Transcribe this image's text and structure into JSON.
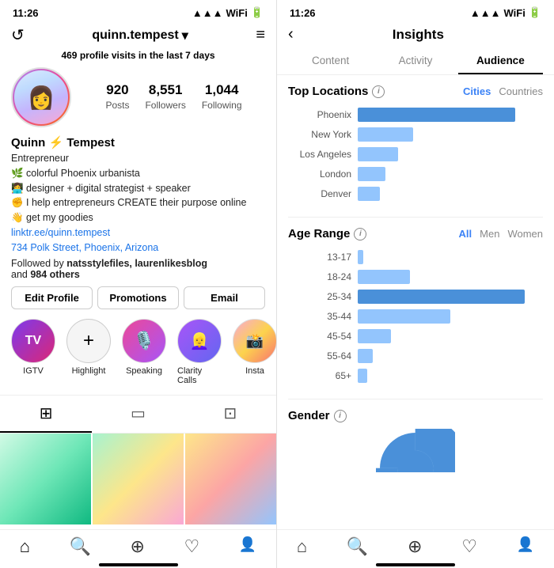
{
  "left": {
    "status_time": "11:26",
    "header": {
      "username": "quinn.tempest",
      "dropdown_icon": "▾",
      "menu_icon": "≡"
    },
    "visits_text": "profile visits in the last 7 days",
    "visits_count": "469",
    "stats": {
      "posts": {
        "value": "920",
        "label": "Posts"
      },
      "followers": {
        "value": "8,551",
        "label": "Followers"
      },
      "following": {
        "value": "1,044",
        "label": "Following"
      }
    },
    "profile_name": "Quinn ⚡ Tempest",
    "bio_lines": [
      "Entrepreneur",
      "🌿 colorful Phoenix urbanista",
      "👩‍💻 designer + digital strategist + speaker",
      "✊ I help entrepreneurs CREATE their purpose online",
      "👋 get my goodies"
    ],
    "link": "linktr.ee/quinn.tempest",
    "address": "734 Polk Street, Phoenix, Arizona",
    "followed_by": "Followed by natsstylefiles, laurenlikesblog",
    "followed_others": "and 984 others",
    "buttons": {
      "edit": "Edit Profile",
      "promotions": "Promotions",
      "email": "Email"
    },
    "highlights": [
      {
        "id": "igtv",
        "label": "IGTV",
        "type": "igtv"
      },
      {
        "id": "highlight",
        "label": "Highlight",
        "type": "add"
      },
      {
        "id": "speaking",
        "label": "Speaking",
        "type": "speaking"
      },
      {
        "id": "calls",
        "label": "Clarity Calls",
        "type": "calls"
      },
      {
        "id": "insta",
        "label": "Insta",
        "type": "insta"
      }
    ],
    "tabs": [
      "grid",
      "reels",
      "tagged"
    ],
    "bottom_nav": [
      "home",
      "search",
      "add",
      "heart",
      "profile"
    ]
  },
  "right": {
    "status_time": "11:26",
    "title": "Insights",
    "tabs": [
      {
        "label": "Content",
        "active": false
      },
      {
        "label": "Activity",
        "active": false
      },
      {
        "label": "Audience",
        "active": true
      }
    ],
    "top_locations": {
      "title": "Top Locations",
      "filters": [
        {
          "label": "Cities",
          "active": true
        },
        {
          "label": "Countries",
          "active": false
        }
      ],
      "bars": [
        {
          "label": "Phoenix",
          "pct": 85,
          "light": false
        },
        {
          "label": "New York",
          "pct": 30,
          "light": true
        },
        {
          "label": "Los Angeles",
          "pct": 22,
          "light": true
        },
        {
          "label": "London",
          "pct": 15,
          "light": true
        },
        {
          "label": "Denver",
          "pct": 12,
          "light": true
        }
      ]
    },
    "age_range": {
      "title": "Age Range",
      "filters": [
        {
          "label": "All",
          "active": true
        },
        {
          "label": "Men",
          "active": false
        },
        {
          "label": "Women",
          "active": false
        }
      ],
      "bars": [
        {
          "label": "13-17",
          "pct": 3,
          "light": true
        },
        {
          "label": "18-24",
          "pct": 28,
          "light": true
        },
        {
          "label": "25-34",
          "pct": 90,
          "light": false
        },
        {
          "label": "35-44",
          "pct": 50,
          "light": true
        },
        {
          "label": "45-54",
          "pct": 18,
          "light": true
        },
        {
          "label": "55-64",
          "pct": 8,
          "light": true
        },
        {
          "label": "65+",
          "pct": 5,
          "light": true
        }
      ]
    },
    "gender": {
      "title": "Gender"
    }
  }
}
